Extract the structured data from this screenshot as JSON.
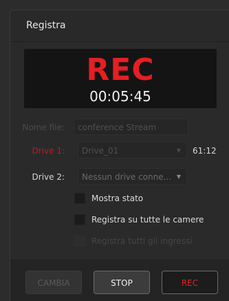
{
  "panel": {
    "title": "Registra"
  },
  "display": {
    "rec_label": "REC",
    "timecode": "00:05:45"
  },
  "form": {
    "filename_label": "Nome file:",
    "filename_value": "conference Stream",
    "drive1_label": "Drive 1:",
    "drive1_value": "Drive_01",
    "drive1_time": "61:12",
    "drive2_label": "Drive 2:",
    "drive2_value": "Nessun drive conne..."
  },
  "checkboxes": [
    {
      "label": "Mostra stato",
      "checked": false,
      "enabled": true
    },
    {
      "label": "Registra su tutte le camere",
      "checked": false,
      "enabled": true
    },
    {
      "label": "Registra tutti gli ingressi",
      "checked": false,
      "enabled": false
    }
  ],
  "buttons": {
    "cambia": "CAMBIA",
    "stop": "STOP",
    "rec": "REC"
  },
  "colors": {
    "rec_red": "#e51f23",
    "background": "#2a2a2a"
  },
  "icons": {
    "dropdown": "chevron-down-icon"
  }
}
